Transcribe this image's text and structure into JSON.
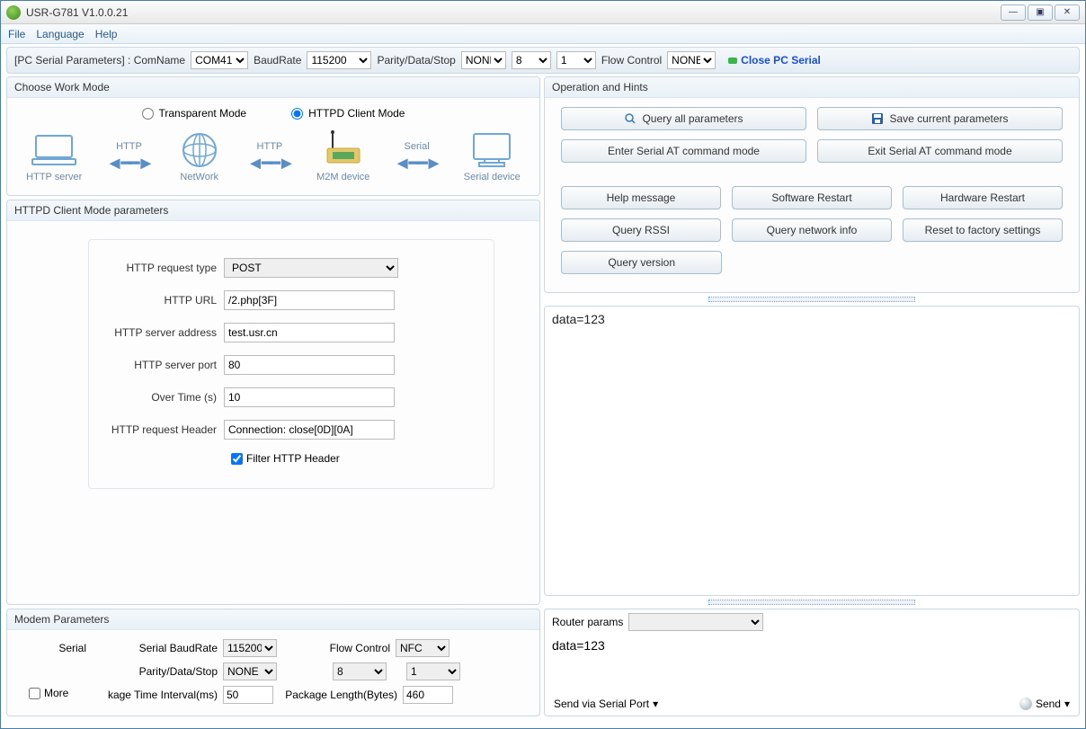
{
  "window": {
    "title": "USR-G781 V1.0.0.21"
  },
  "menu": {
    "file": "File",
    "language": "Language",
    "help": "Help"
  },
  "toolbar": {
    "pc_label": "[PC Serial Parameters] : ComName",
    "comname": "COM41",
    "baud_label": "BaudRate",
    "baud": "115200",
    "pds_label": "Parity/Data/Stop",
    "parity": "NONE",
    "databits": "8",
    "stopbits": "1",
    "flow_label": "Flow Control",
    "flow": "NONE",
    "close": "Close PC Serial"
  },
  "workmode": {
    "title": "Choose Work Mode",
    "transparent": "Transparent Mode",
    "httpd": "HTTPD Client Mode",
    "diag": {
      "http_server": "HTTP server",
      "network": "NetWork",
      "m2m": "M2M device",
      "serial_dev": "Serial device",
      "http": "HTTP",
      "serial": "Serial"
    }
  },
  "httpd": {
    "title": "HTTPD Client Mode parameters",
    "req_type_l": "HTTP request type",
    "req_type": "POST",
    "url_l": "HTTP URL",
    "url": "/2.php[3F]",
    "addr_l": "HTTP server address",
    "addr": "test.usr.cn",
    "port_l": "HTTP server port",
    "port": "80",
    "over_l": "Over Time (s)",
    "over": "10",
    "header_l": "HTTP request Header",
    "header": "Connection: close[0D][0A]",
    "filter": "Filter HTTP Header"
  },
  "modem": {
    "title": "Modem Parameters",
    "serial_l": "Serial",
    "baud_l": "Serial BaudRate",
    "baud": "115200",
    "flow_l": "Flow Control",
    "flow": "NFC",
    "pds_l": "Parity/Data/Stop",
    "parity": "NONE",
    "data": "8",
    "stop": "1",
    "pti_l": "kage Time Interval(ms)",
    "pti": "50",
    "plen_l": "Package Length(Bytes)",
    "plen": "460",
    "more": "More"
  },
  "ops": {
    "title": "Operation and Hints",
    "query_all": "Query all parameters",
    "save": "Save current parameters",
    "enter_at": "Enter Serial AT command mode",
    "exit_at": "Exit Serial AT command mode",
    "help": "Help message",
    "sw_restart": "Software Restart",
    "hw_restart": "Hardware Restart",
    "query_rssi": "Query RSSI",
    "query_net": "Query network info",
    "reset": "Reset to factory settings",
    "query_ver": "Query version"
  },
  "console": {
    "text": "data=123"
  },
  "send": {
    "router_l": "Router params",
    "text": "data=123",
    "via": "Send via Serial Port",
    "send": "Send"
  }
}
